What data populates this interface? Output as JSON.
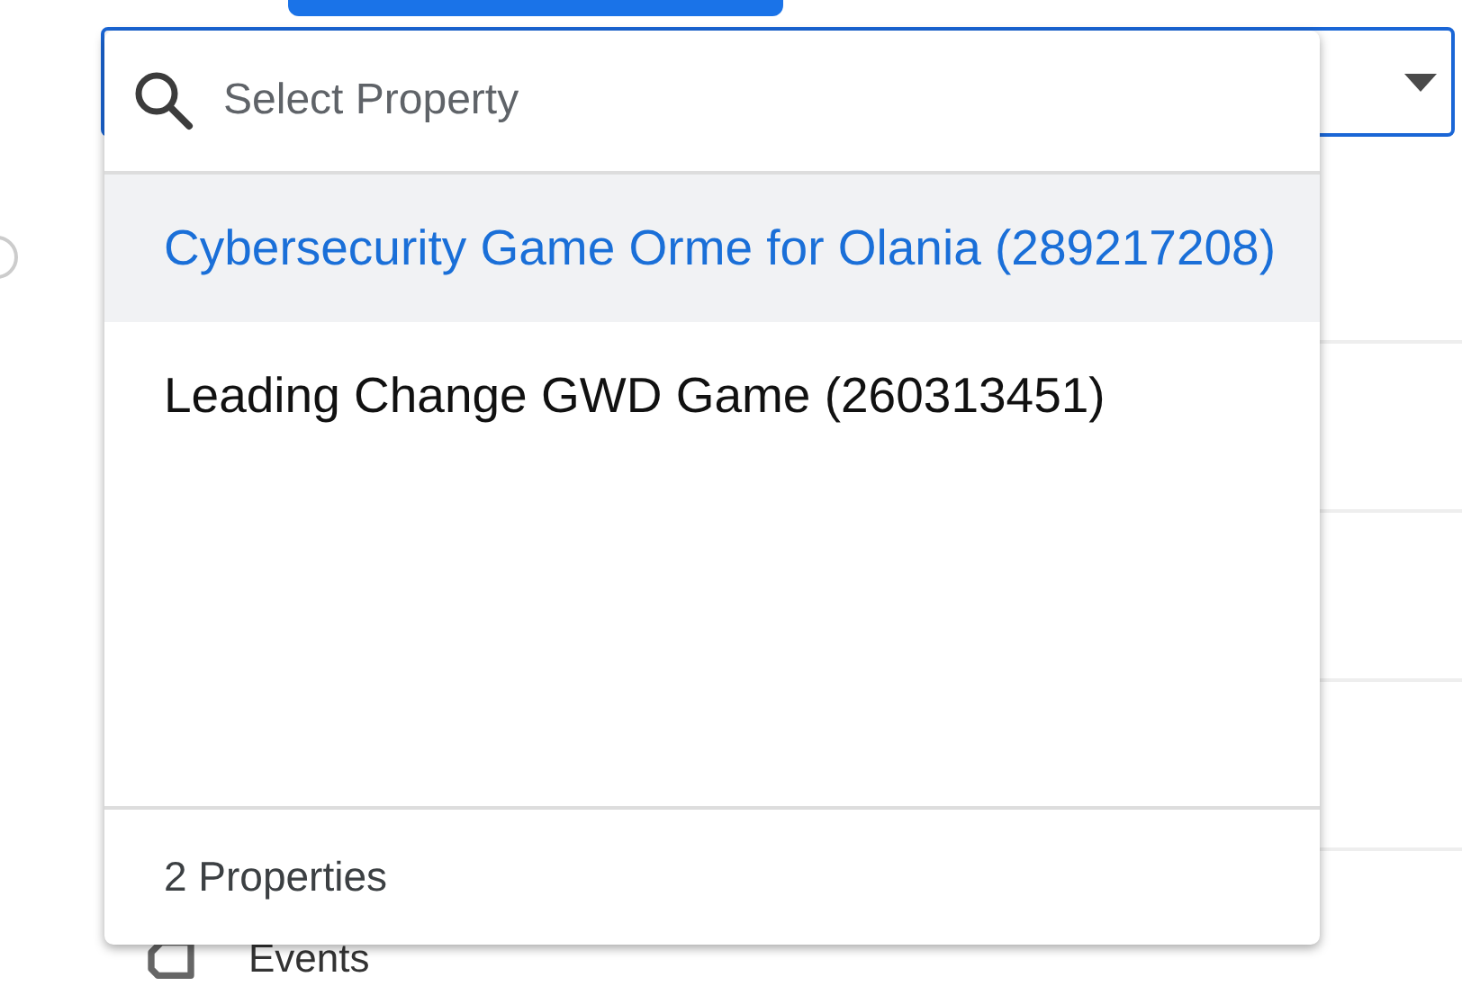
{
  "search": {
    "placeholder": "Select Property"
  },
  "options": [
    {
      "label": "Cybersecurity Game Orme for Olania (289217208)",
      "selected": true
    },
    {
      "label": "Leading Change GWD Game (260313451)",
      "selected": false
    }
  ],
  "footer": "2 Properties",
  "nav_item": {
    "label": "Events"
  }
}
